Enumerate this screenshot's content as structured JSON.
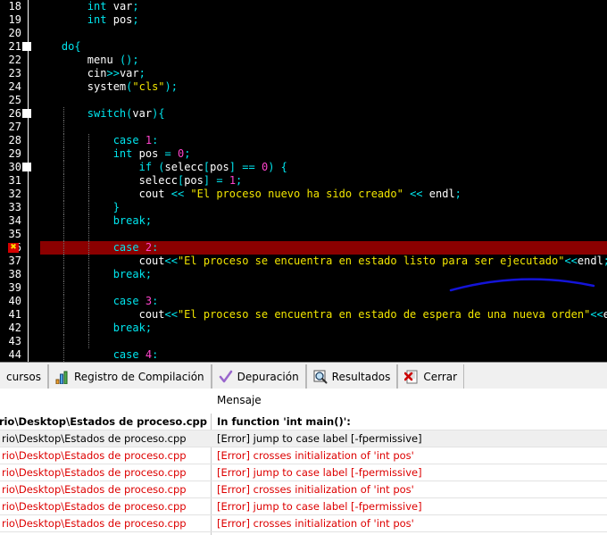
{
  "editor": {
    "background": "#000000",
    "gutter_color": "#ffffff",
    "error_line": 36,
    "error_marker_glyph": "✖",
    "colors": {
      "keyword": "#00e5ee",
      "number": "#ff44cc",
      "string": "#f2e600",
      "plain": "#ffffff",
      "error_line_bg": "#8b0000",
      "annotation": "#1414d8"
    },
    "lines": [
      {
        "num": "18",
        "fold": false,
        "error": false,
        "highlight": false,
        "text": "        int var;"
      },
      {
        "num": "19",
        "fold": false,
        "error": false,
        "highlight": false,
        "text": "        int pos;"
      },
      {
        "num": "20",
        "fold": false,
        "error": false,
        "highlight": false,
        "text": ""
      },
      {
        "num": "21",
        "fold": true,
        "error": false,
        "highlight": false,
        "text": "    do{"
      },
      {
        "num": "22",
        "fold": false,
        "error": false,
        "highlight": false,
        "text": "        menu ();"
      },
      {
        "num": "23",
        "fold": false,
        "error": false,
        "highlight": false,
        "text": "        cin>>var;"
      },
      {
        "num": "24",
        "fold": false,
        "error": false,
        "highlight": false,
        "text": "        system(\"cls\");"
      },
      {
        "num": "25",
        "fold": false,
        "error": false,
        "highlight": false,
        "text": ""
      },
      {
        "num": "26",
        "fold": true,
        "error": false,
        "highlight": false,
        "text": "        switch(var){"
      },
      {
        "num": "27",
        "fold": false,
        "error": false,
        "highlight": false,
        "text": ""
      },
      {
        "num": "28",
        "fold": false,
        "error": false,
        "highlight": false,
        "text": "            case 1:"
      },
      {
        "num": "29",
        "fold": false,
        "error": false,
        "highlight": false,
        "text": "            int pos = 0;"
      },
      {
        "num": "30",
        "fold": true,
        "error": false,
        "highlight": false,
        "text": "                if (selecc[pos] == 0) {"
      },
      {
        "num": "31",
        "fold": false,
        "error": false,
        "highlight": false,
        "text": "                selecc[pos] = 1;"
      },
      {
        "num": "32",
        "fold": false,
        "error": false,
        "highlight": false,
        "text": "                cout << \"El proceso nuevo ha sido creado\" << endl;"
      },
      {
        "num": "33",
        "fold": false,
        "error": false,
        "highlight": false,
        "text": "            }"
      },
      {
        "num": "34",
        "fold": false,
        "error": false,
        "highlight": false,
        "text": "            break;"
      },
      {
        "num": "35",
        "fold": false,
        "error": false,
        "highlight": false,
        "text": ""
      },
      {
        "num": "36",
        "fold": false,
        "error": true,
        "highlight": true,
        "text": "            case 2:"
      },
      {
        "num": "37",
        "fold": false,
        "error": false,
        "highlight": false,
        "text": "                cout<<\"El proceso se encuentra en estado listo para ser ejecutado\"<<endl;"
      },
      {
        "num": "38",
        "fold": false,
        "error": false,
        "highlight": false,
        "text": "            break;"
      },
      {
        "num": "39",
        "fold": false,
        "error": false,
        "highlight": false,
        "text": ""
      },
      {
        "num": "40",
        "fold": false,
        "error": false,
        "highlight": false,
        "text": "            case 3:"
      },
      {
        "num": "41",
        "fold": false,
        "error": false,
        "highlight": false,
        "text": "                cout<<\"El proceso se encuentra en estado de espera de una nueva orden\"<<endl;"
      },
      {
        "num": "42",
        "fold": false,
        "error": false,
        "highlight": false,
        "text": "            break;"
      },
      {
        "num": "43",
        "fold": false,
        "error": false,
        "highlight": false,
        "text": ""
      },
      {
        "num": "44",
        "fold": false,
        "error": false,
        "highlight": false,
        "text": "            case 4:"
      }
    ]
  },
  "bottom_panel": {
    "tabs": [
      {
        "label": "cursos",
        "icon": "",
        "truncated": true
      },
      {
        "label": "Registro de Compilación",
        "icon": "bar-chart-icon"
      },
      {
        "label": "Depuración",
        "icon": "check-icon"
      },
      {
        "label": "Resultados",
        "icon": "magnifier-icon"
      },
      {
        "label": "Cerrar",
        "icon": "close-document-icon"
      }
    ],
    "columns": [
      {
        "key": "file",
        "label": ""
      },
      {
        "key": "message",
        "label": "Mensaje"
      }
    ],
    "rows": [
      {
        "file": "rio\\Desktop\\Estados de proceso.cpp",
        "message": "In function 'int main()':",
        "style": "bold",
        "selected": false
      },
      {
        "file": "rio\\Desktop\\Estados de proceso.cpp",
        "message": "[Error] jump to case label [-fpermissive]",
        "style": "plain",
        "selected": true
      },
      {
        "file": "rio\\Desktop\\Estados de proceso.cpp",
        "message": "[Error] crosses initialization of 'int pos'",
        "style": "error",
        "selected": false
      },
      {
        "file": "rio\\Desktop\\Estados de proceso.cpp",
        "message": "[Error] jump to case label [-fpermissive]",
        "style": "error",
        "selected": false
      },
      {
        "file": "rio\\Desktop\\Estados de proceso.cpp",
        "message": "[Error] crosses initialization of 'int pos'",
        "style": "error",
        "selected": false
      },
      {
        "file": "rio\\Desktop\\Estados de proceso.cpp",
        "message": "[Error] jump to case label [-fpermissive]",
        "style": "error",
        "selected": false
      },
      {
        "file": "rio\\Desktop\\Estados de proceso.cpp",
        "message": "[Error] crosses initialization of 'int pos'",
        "style": "error",
        "selected": false
      }
    ]
  }
}
